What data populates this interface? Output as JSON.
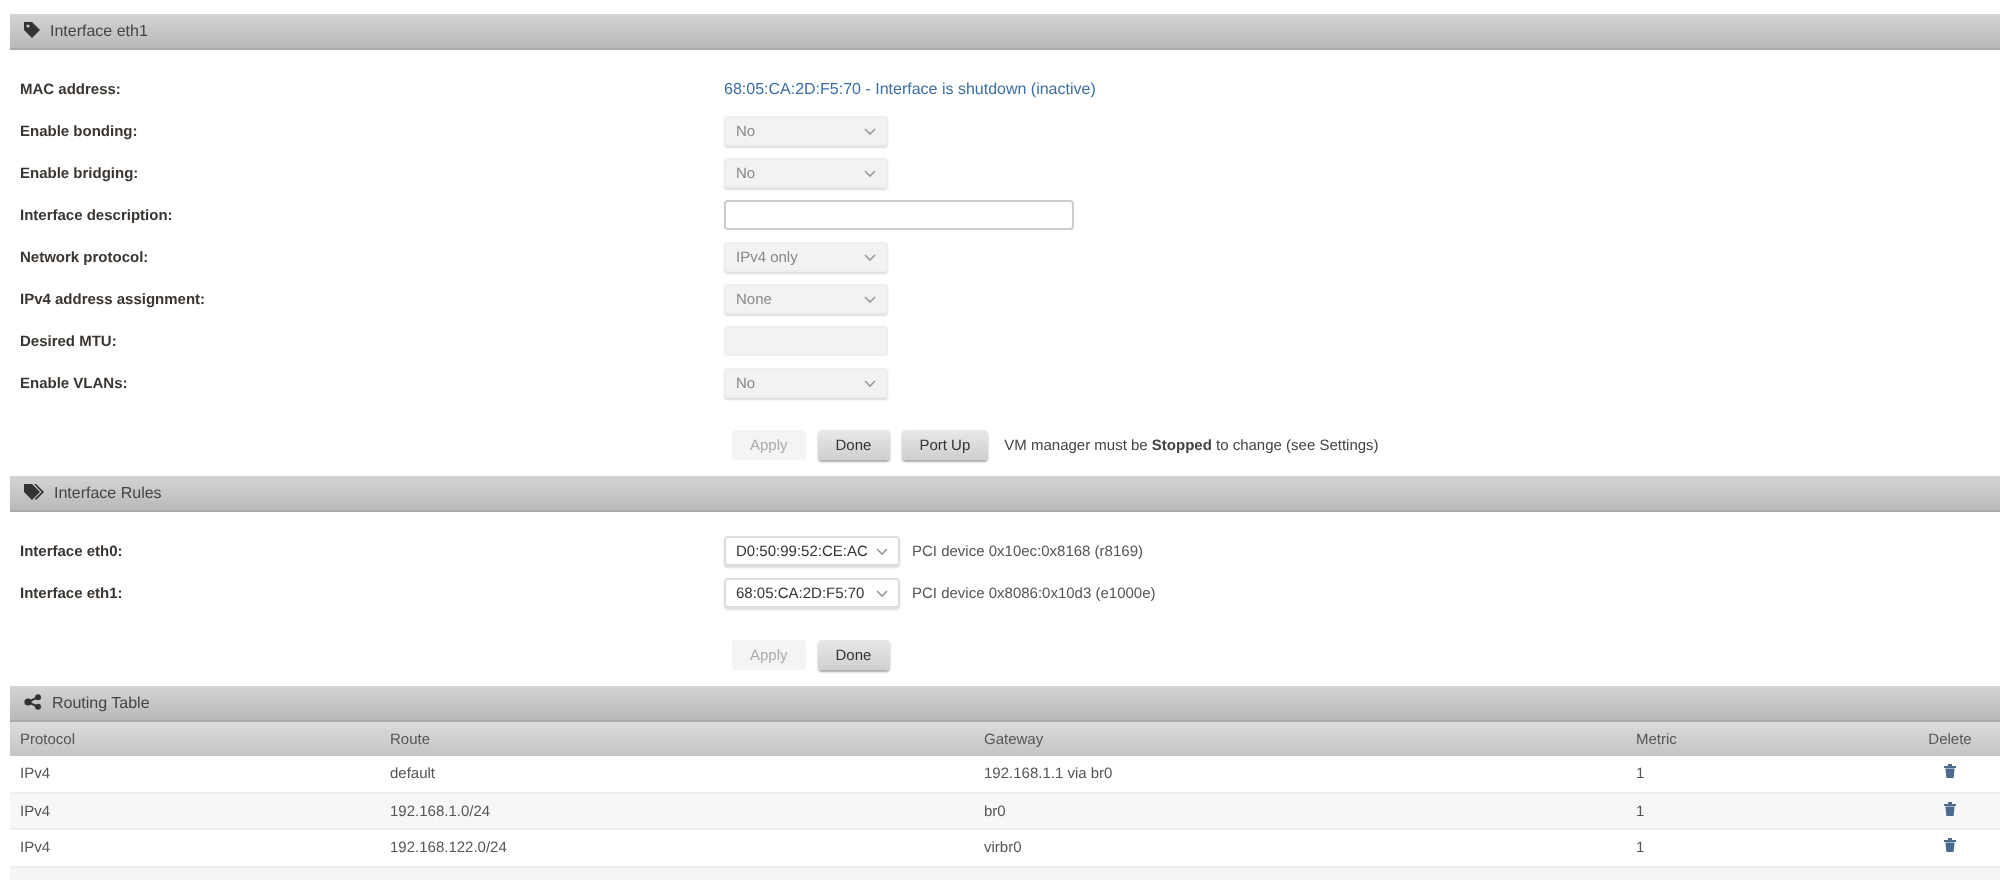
{
  "panels": [
    {
      "title": "Interface eth1",
      "fields": [
        {
          "label": "MAC address:",
          "kind": "text",
          "value": "68:05:CA:2D:F5:70 - Interface is shutdown (inactive)"
        },
        {
          "label": "Enable bonding:",
          "kind": "select",
          "value": "No",
          "disabled": true
        },
        {
          "label": "Enable bridging:",
          "kind": "select",
          "value": "No",
          "disabled": true
        },
        {
          "label": "Interface description:",
          "kind": "input",
          "disabled": false
        },
        {
          "label": "Network protocol:",
          "kind": "select",
          "value": "IPv4 only",
          "disabled": true
        },
        {
          "label": "IPv4 address assignment:",
          "kind": "select",
          "value": "None",
          "disabled": true
        },
        {
          "label": "Desired MTU:",
          "kind": "input",
          "disabled": true
        },
        {
          "label": "Enable VLANs:",
          "kind": "select",
          "value": "No",
          "disabled": true
        }
      ],
      "buttons": [
        {
          "label": "Apply",
          "disabled": true
        },
        {
          "label": "Done",
          "disabled": false
        },
        {
          "label": "Port Up",
          "disabled": false
        }
      ],
      "note": "VM manager must be **Stopped** to change (see Settings)"
    },
    {
      "title": "Interface Rules",
      "fields": [
        {
          "label": "Interface eth0:",
          "kind": "select",
          "value": "D0:50:99:52:CE:AC",
          "disabled": false,
          "description": "PCI device 0x10ec:0x8168 (r8169)"
        },
        {
          "label": "Interface eth1:",
          "kind": "select",
          "value": "68:05:CA:2D:F5:70",
          "disabled": false,
          "description": "PCI device 0x8086:0x10d3 (e1000e)"
        }
      ],
      "buttons": [
        {
          "label": "Apply",
          "disabled": true
        },
        {
          "label": "Done",
          "disabled": false
        }
      ]
    },
    {
      "title": "Routing Table",
      "table": {
        "columns": [
          "Protocol",
          "Route",
          "Gateway",
          "Metric",
          "Delete"
        ],
        "rows": [
          {
            "protocol": "IPv4",
            "route": "default",
            "gateway": "192.168.1.1 via br0",
            "metric": "1"
          },
          {
            "protocol": "IPv4",
            "route": "192.168.1.0/24",
            "gateway": "br0",
            "metric": "1"
          },
          {
            "protocol": "IPv4",
            "route": "192.168.122.0/24",
            "gateway": "virbr0",
            "metric": "1"
          }
        ]
      }
    }
  ]
}
